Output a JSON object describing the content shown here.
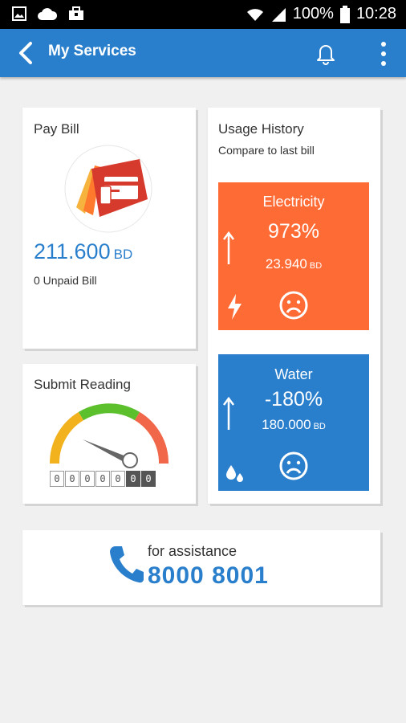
{
  "status_bar": {
    "icons": [
      "image-icon",
      "cloud-icon",
      "briefcase-icon",
      "wifi-icon",
      "signal-icon",
      "battery-icon"
    ],
    "battery": "100%",
    "time": "10:28"
  },
  "app_bar": {
    "title": "My Services",
    "icons": [
      "back-icon",
      "bell-icon",
      "more-icon"
    ],
    "color": "#2a7fcc"
  },
  "pay_bill": {
    "title": "Pay Bill",
    "amount": "211.600",
    "currency": "BD",
    "unpaid": "0 Unpaid Bill"
  },
  "submit_reading": {
    "title": "Submit Reading",
    "digits": [
      "0",
      "0",
      "0",
      "0",
      "0",
      "0",
      "0"
    ]
  },
  "usage_history": {
    "title": "Usage History",
    "subtitle": "Compare to last bill",
    "electricity": {
      "name": "Electricity",
      "percent": "973%",
      "amount": "23.940",
      "currency": "BD",
      "color": "#ff6b35"
    },
    "water": {
      "name": "Water",
      "percent": "-180%",
      "amount": "180.000",
      "currency": "BD",
      "color": "#2a7fcc"
    }
  },
  "assistance": {
    "label": "for assistance",
    "number": "8000 8001"
  }
}
